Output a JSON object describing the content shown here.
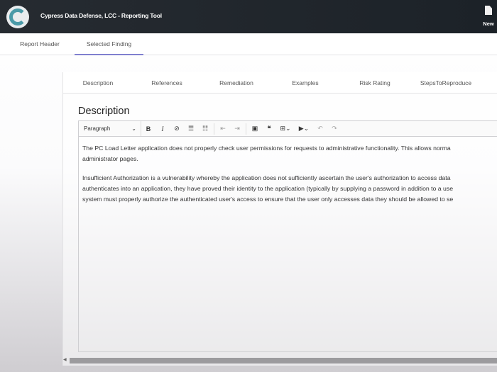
{
  "app": {
    "title": "Cypress Data Defense, LCC - Reporting Tool",
    "new_label": "New"
  },
  "top_tabs": [
    {
      "label": "Report Header"
    },
    {
      "label": "Selected Finding",
      "active": true
    }
  ],
  "inner_tabs": [
    {
      "label": "Description"
    },
    {
      "label": "References"
    },
    {
      "label": "Remediation"
    },
    {
      "label": "Examples"
    },
    {
      "label": "Risk Rating"
    },
    {
      "label": "StepsToReproduce"
    }
  ],
  "section_title": "Description",
  "toolbar": {
    "block_format": "Paragraph",
    "buttons": [
      "bold",
      "italic",
      "link",
      "bulleted-list",
      "numbered-list",
      "outdent",
      "indent",
      "image",
      "blockquote",
      "table",
      "media",
      "undo",
      "redo"
    ]
  },
  "content": {
    "paragraphs": [
      "The PC Load Letter application does not properly check user permissions for requests to administrative functionality. This allows norma",
      "administrator pages.",
      "Insufficient Authorization is a vulnerability whereby the application does not sufficiently ascertain the user's authorization to access data",
      "authenticates into an application, they have proved their identity to the application (typically by supplying a password in addition to a use",
      "system must properly authorize the authenticated user's access to ensure that the user only accesses data they should be allowed to se"
    ]
  },
  "colors": {
    "header": "#22272d",
    "accent": "#7f7fcf",
    "logo": "#4a9aa8"
  }
}
